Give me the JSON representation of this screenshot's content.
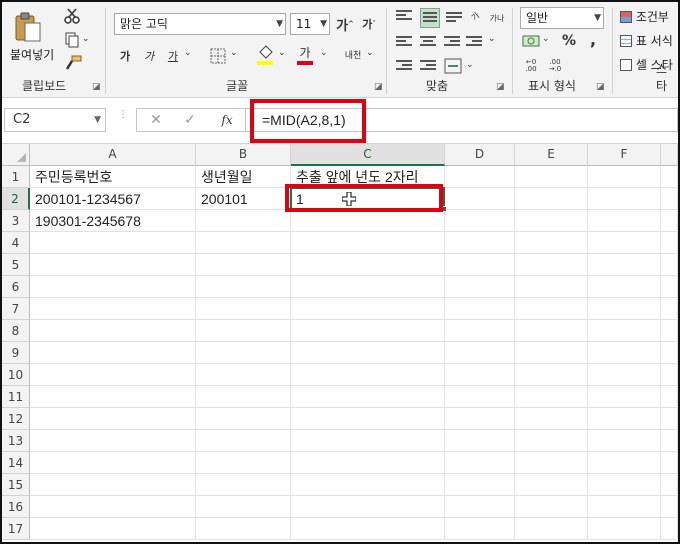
{
  "ribbon": {
    "clipboard": {
      "paste_label": "붙여넣기",
      "group_label": "클립보드"
    },
    "font": {
      "name": "맑은 고딕",
      "size": "11",
      "group_label": "글꼴",
      "bold": "가",
      "italic": "가",
      "underline": "가",
      "grow": "가",
      "shrink": "가",
      "color_letter": "가",
      "phonetic": "내천"
    },
    "alignment": {
      "group_label": "맞춤"
    },
    "number": {
      "format": "일반",
      "group_label": "표시 형식",
      "percent": "%",
      "comma": ","
    },
    "styles": {
      "conditional": "조건부",
      "table": "표 서식",
      "cell": "셀 스타",
      "group_label": "스타"
    },
    "colors": {
      "accent": "#217346",
      "highlight_red": "#e0000f",
      "font_color_bar": "#e0000f",
      "fill_color_bar": "#ffff00"
    }
  },
  "formula_bar": {
    "name_box": "C2",
    "fx": "fx",
    "formula": "=MID(A2,8,1)"
  },
  "sheet": {
    "columns": [
      "A",
      "B",
      "C",
      "D",
      "E",
      "F"
    ],
    "rows": [
      "1",
      "2",
      "3",
      "4",
      "5",
      "6",
      "7",
      "8",
      "9",
      "10",
      "11",
      "12",
      "13",
      "14",
      "15",
      "16",
      "17"
    ],
    "cells": {
      "A1": "주민등록번호",
      "B1": "생년월일",
      "C1": "추출 앞에 년도 2자리",
      "A2": "200101-1234567",
      "B2": "200101",
      "C2": "1",
      "A3": "190301-2345678"
    },
    "active_cell": "C2"
  }
}
